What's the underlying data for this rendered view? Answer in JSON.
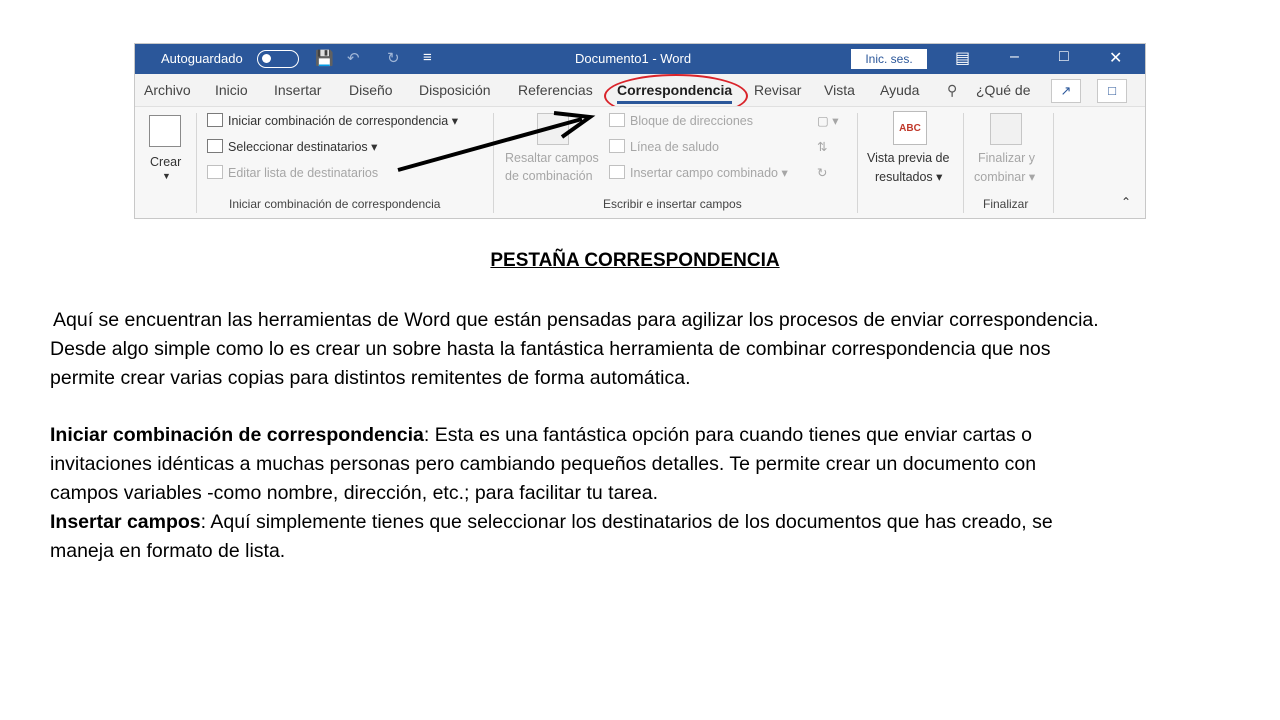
{
  "word": {
    "titlebar": {
      "autosave_label": "Autoguardado",
      "doc_title": "Documento1  -  Word",
      "signin_label": "Inic. ses."
    },
    "tabs": [
      "Archivo",
      "Inicio",
      "Insertar",
      "Diseño",
      "Disposición",
      "Referencias",
      "Correspondencia",
      "Revisar",
      "Vista",
      "Ayuda"
    ],
    "active_tab": "Correspondencia",
    "tell_me": "¿Qué de",
    "ribbon": {
      "crear": "Crear",
      "iniciar_combinacion": "Iniciar combinación de correspondencia",
      "seleccionar_destinatarios": "Seleccionar destinatarios",
      "editar_lista": "Editar lista de destinatarios",
      "group1_label": "Iniciar combinación de correspondencia",
      "resaltar_campos_1": "Resaltar campos",
      "resaltar_campos_2": "de combinación",
      "bloque_direcciones": "Bloque de direcciones",
      "linea_saludo": "Línea de saludo",
      "insertar_campo": "Insertar campo combinado",
      "group2_label": "Escribir e insertar campos",
      "vista_previa_1": "Vista previa de",
      "vista_previa_2": "resultados",
      "finalizar_1": "Finalizar y",
      "finalizar_2": "combinar",
      "group3_label": "Finalizar",
      "abc_icon_text": "ABC"
    },
    "accent_color": "#2b579a",
    "highlight_color": "#d9232a"
  },
  "document": {
    "heading": "PESTAÑA CORRESPONDENCIA",
    "intro_line1": "Aquí se encuentran las herramientas de Word que están pensadas para agilizar los procesos de enviar correspondencia.",
    "intro_line2": "Desde algo simple como lo es crear un sobre hasta la fantástica herramienta de combinar correspondencia que nos",
    "intro_line3": "permite crear varias copias para distintos remitentes de forma automática.",
    "item1_title": "Iniciar combinación de correspondencia",
    "item1_line1": ": Esta es una fantástica opción para cuando tienes que enviar cartas o",
    "item1_line2": "invitaciones idénticas a muchas personas pero cambiando pequeños detalles. Te permite crear un documento con",
    "item1_line3": "campos variables -como nombre, dirección, etc.;  para facilitar tu tarea.",
    "item2_title": "Insertar campos",
    "item2_line1": ": Aquí simplemente tienes que seleccionar los destinatarios de los documentos que has creado, se",
    "item2_line2": "maneja en formato de lista."
  }
}
